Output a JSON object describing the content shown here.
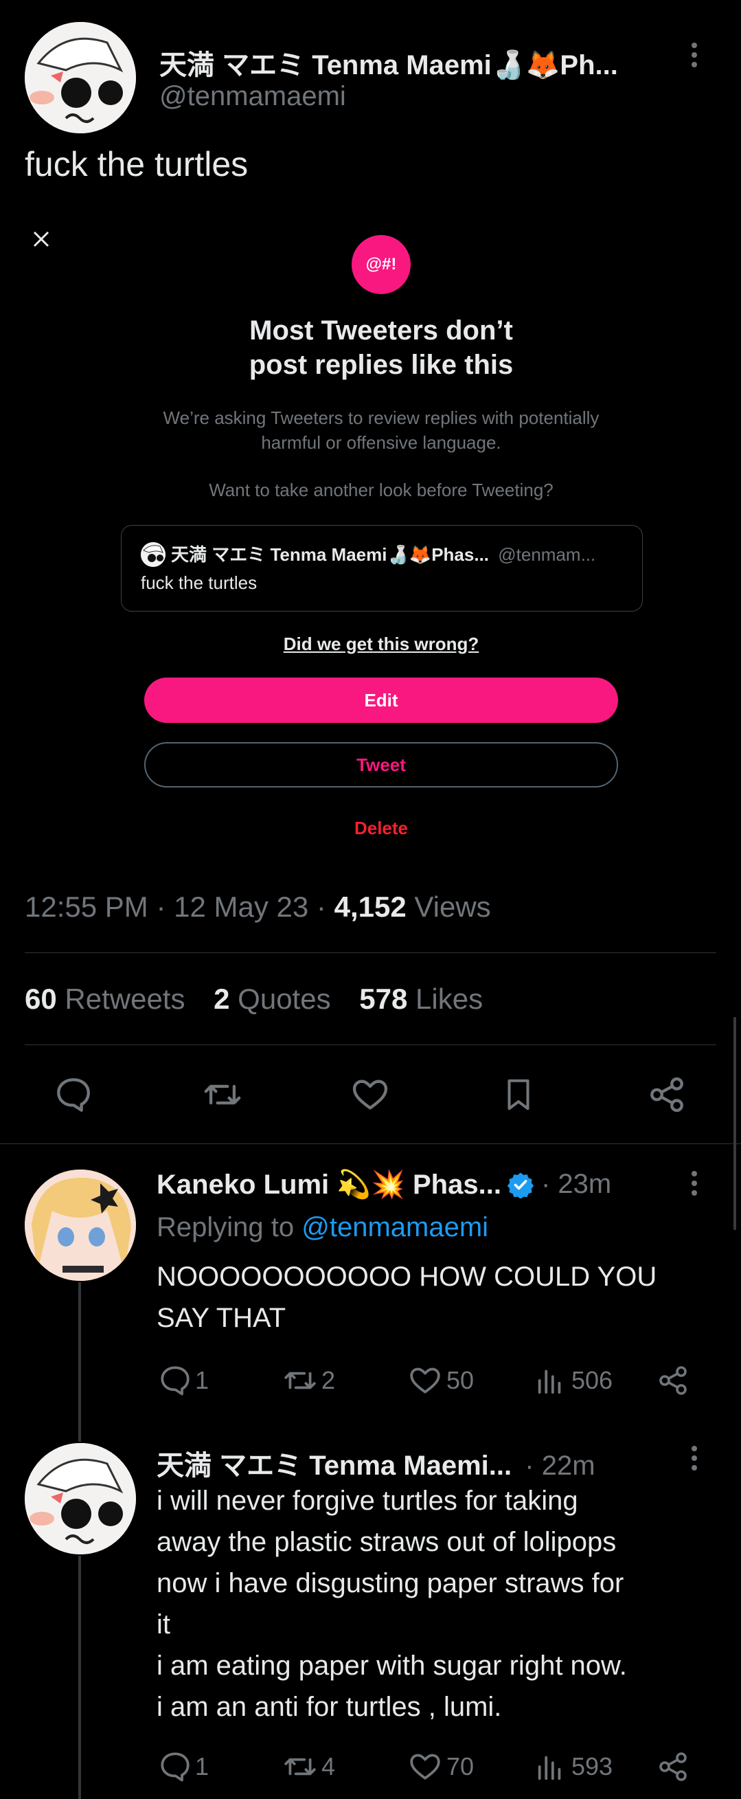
{
  "main_tweet": {
    "display_name": "天満 マエミ Tenma Maemi🍶🦊Ph...",
    "handle": "@tenmamaemi",
    "text": "fuck the turtles"
  },
  "prompt": {
    "badge": "@#!",
    "title_line1": "Most Tweeters don’t",
    "title_line2": "post replies like this",
    "body_line1": "We’re asking Tweeters to review replies with potentially",
    "body_line2": "harmful or offensive language.",
    "question": "Want to take another look before Tweeting?",
    "preview_name": "天満 マエミ Tenma Maemi🍶🦊Phas...",
    "preview_handle": "@tenmam...",
    "preview_text": "fuck the turtles",
    "wrong_link": "Did we get this wrong?",
    "edit_label": "Edit",
    "tweet_label": "Tweet",
    "delete_label": "Delete"
  },
  "meta": {
    "time": "12:55 PM",
    "sep1": "·",
    "date": "12 May 23",
    "sep2": "·",
    "views_count": "4,152",
    "views_label": "Views"
  },
  "stats": {
    "retweets_count": "60",
    "retweets_label": "Retweets",
    "quotes_count": "2",
    "quotes_label": "Quotes",
    "likes_count": "578",
    "likes_label": "Likes"
  },
  "replies": [
    {
      "display_name": "Kaneko Lumi 💫💥 Phas...",
      "time": "· 23m",
      "replying_prefix": "Replying to",
      "replying_handle": "@tenmamaemi",
      "line1": "NOOOOOOOOOOO HOW COULD YOU",
      "line2": "SAY THAT",
      "replies": "1",
      "retweets": "2",
      "likes": "50",
      "views": "506"
    },
    {
      "display_name": "天満 マエミ Tenma Maemi...",
      "time": "· 22m",
      "line1": "i will never forgive turtles for taking",
      "line2": "away the plastic straws out of lolipops",
      "line3": "now i have disgusting paper straws for",
      "line4": "it",
      "line5": "i am eating paper with sugar right now.",
      "line6": "i am an anti for turtles , lumi.",
      "replies": "1",
      "retweets": "4",
      "likes": "70",
      "views": "593"
    }
  ],
  "colors": {
    "accent_pink": "#f91880",
    "link_blue": "#1d9bf0",
    "delete_red": "#f4212e",
    "verified_blue": "#1d9bf0"
  }
}
